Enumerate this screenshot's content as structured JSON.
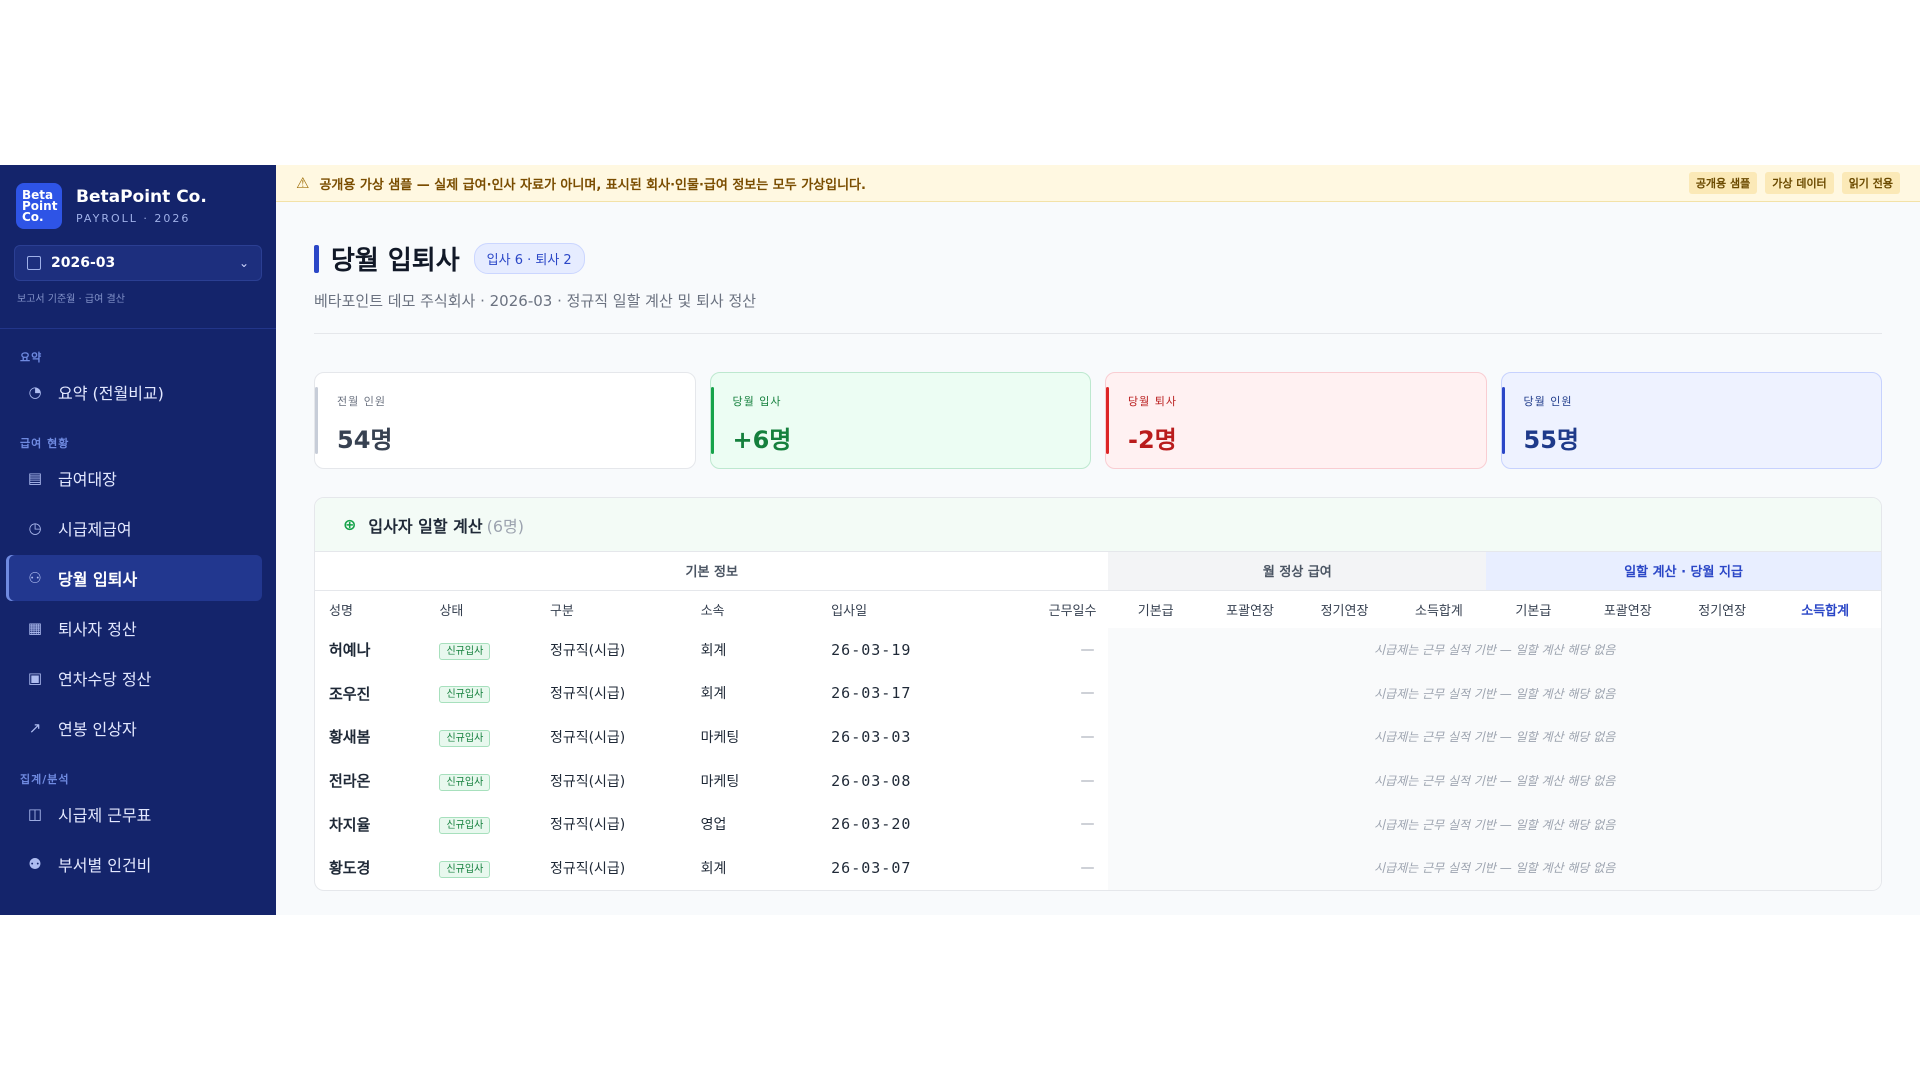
{
  "sidebar": {
    "logo": [
      "Beta",
      "Point",
      "Co."
    ],
    "company": "BetaPoint Co.",
    "product": "PAYROLL · 2026",
    "period": "2026-03",
    "period_hint": "보고서 기준월 · 급여 결산",
    "sections": [
      {
        "label": "요약",
        "items": [
          {
            "label": "요약 (전월비교)",
            "icon": "pie-chart-icon"
          }
        ]
      },
      {
        "label": "급여 현황",
        "items": [
          {
            "label": "급여대장",
            "icon": "document-icon"
          },
          {
            "label": "시급제급여",
            "icon": "clock-icon"
          },
          {
            "label": "당월 입퇴사",
            "icon": "user-icon",
            "active": true
          },
          {
            "label": "퇴사자 정산",
            "icon": "calculator-icon"
          },
          {
            "label": "연차수당 정산",
            "icon": "calendar-icon"
          },
          {
            "label": "연봉 인상자",
            "icon": "trend-up-icon"
          }
        ]
      },
      {
        "label": "집계/분석",
        "items": [
          {
            "label": "시급제 근무표",
            "icon": "calendar-clock-icon"
          },
          {
            "label": "부서별 인건비",
            "icon": "users-icon"
          }
        ]
      }
    ]
  },
  "banner": {
    "message": "공개용 가상 샘플 — 실제 급여·인사 자료가 아니며, 표시된 회사·인물·급여 정보는 모두 가상입니다.",
    "chips": [
      "공개용 샘플",
      "가상 데이터",
      "읽기 전용"
    ]
  },
  "page": {
    "title": "당월 입퇴사",
    "pill": "입사 6 · 퇴사 2",
    "subtitle": "베타포인트 데모 주식회사 · 2026-03 · 정규직 일할 계산 및 퇴사 정산"
  },
  "cards": [
    {
      "label": "전월 인원",
      "value": "54명"
    },
    {
      "label": "당월 입사",
      "value": "+6명"
    },
    {
      "label": "당월 퇴사",
      "value": "-2명"
    },
    {
      "label": "당월 인원",
      "value": "55명"
    }
  ],
  "panel": {
    "title": "입사자 일할 계산",
    "count": "(6명)",
    "groups": [
      "기본 정보",
      "월 정상 급여",
      "일할 계산 · 당월 지급"
    ],
    "columns": [
      "성명",
      "상태",
      "구분",
      "소속",
      "입사일",
      "근무일수",
      "기본급",
      "포괄연장",
      "정기연장",
      "소득합계",
      "기본급",
      "포괄연장",
      "정기연장",
      "소득합계"
    ],
    "rows": [
      {
        "name": "허예나",
        "status": "신규입사",
        "type": "정규직(시급)",
        "dept": "회계",
        "date": "26-03-19",
        "days": "—",
        "note": "시급제는 근무 실적 기반 — 일할 계산 해당 없음"
      },
      {
        "name": "조우진",
        "status": "신규입사",
        "type": "정규직(시급)",
        "dept": "회계",
        "date": "26-03-17",
        "days": "—",
        "note": "시급제는 근무 실적 기반 — 일할 계산 해당 없음"
      },
      {
        "name": "황새봄",
        "status": "신규입사",
        "type": "정규직(시급)",
        "dept": "마케팅",
        "date": "26-03-03",
        "days": "—",
        "note": "시급제는 근무 실적 기반 — 일할 계산 해당 없음"
      },
      {
        "name": "전라온",
        "status": "신규입사",
        "type": "정규직(시급)",
        "dept": "마케팅",
        "date": "26-03-08",
        "days": "—",
        "note": "시급제는 근무 실적 기반 — 일할 계산 해당 없음"
      },
      {
        "name": "차지율",
        "status": "신규입사",
        "type": "정규직(시급)",
        "dept": "영업",
        "date": "26-03-20",
        "days": "—",
        "note": "시급제는 근무 실적 기반 — 일할 계산 해당 없음"
      },
      {
        "name": "황도경",
        "status": "신규입사",
        "type": "정규직(시급)",
        "dept": "회계",
        "date": "26-03-07",
        "days": "—",
        "note": "시급제는 근무 실적 기반 — 일할 계산 해당 없음"
      }
    ]
  }
}
